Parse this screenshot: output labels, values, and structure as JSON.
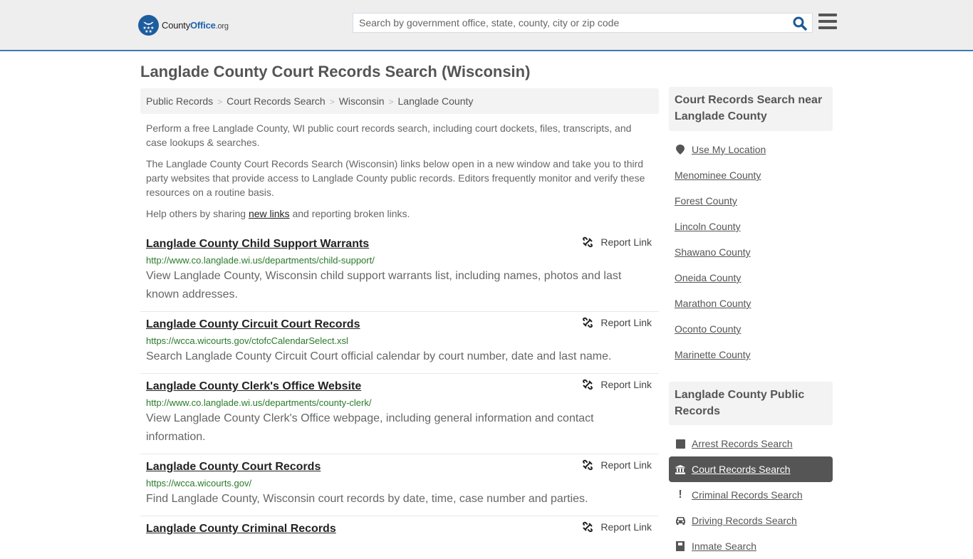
{
  "header": {
    "logo": {
      "name_part1": "County",
      "name_part2": "Office",
      "tld": ".org"
    },
    "search": {
      "placeholder": "Search by government office, state, county, city or zip code",
      "value": ""
    },
    "search_icon": "search-icon",
    "menu_icon": "hamburger-menu-icon"
  },
  "page": {
    "title": "Langlade County Court Records Search (Wisconsin)",
    "breadcrumb": [
      "Public Records",
      "Court Records Search",
      "Wisconsin",
      "Langlade County"
    ],
    "intro": {
      "p1": "Perform a free Langlade County, WI public court records search, including court dockets, files, transcripts, and case lookups & searches.",
      "p2": "The Langlade County Court Records Search (Wisconsin) links below open in a new window and take you to third party websites that provide access to Langlade County public records. Editors frequently monitor and verify these resources on a routine basis.",
      "p3_before": "Help others by sharing ",
      "p3_link": "new links",
      "p3_after": " and reporting broken links."
    }
  },
  "results": [
    {
      "title": "Langlade County Child Support Warrants",
      "url": "http://www.co.langlade.wi.us/departments/child-support/",
      "description": "View Langlade County, Wisconsin child support warrants list, including names, photos and last known addresses.",
      "report_label": "Report Link"
    },
    {
      "title": "Langlade County Circuit Court Records",
      "url": "https://wcca.wicourts.gov/ctofcCalendarSelect.xsl",
      "description": "Search Langlade County Circuit Court official calendar by court number, date and last name.",
      "report_label": "Report Link"
    },
    {
      "title": "Langlade County Clerk's Office Website",
      "url": "http://www.co.langlade.wi.us/departments/county-clerk/",
      "description": "View Langlade County Clerk's Office webpage, including general information and contact information.",
      "report_label": "Report Link"
    },
    {
      "title": "Langlade County Court Records",
      "url": "https://wcca.wicourts.gov/",
      "description": "Find Langlade County, Wisconsin court records by date, time, case number and parties.",
      "report_label": "Report Link"
    },
    {
      "title": "Langlade County Criminal Records",
      "url": "",
      "description": "",
      "report_label": "Report Link"
    }
  ],
  "sidebar": {
    "nearby": {
      "heading": "Court Records Search near Langlade County",
      "use_location": "Use My Location",
      "counties": [
        "Menominee County",
        "Forest County",
        "Lincoln County",
        "Shawano County",
        "Oneida County",
        "Marathon County",
        "Oconto County",
        "Marinette County"
      ]
    },
    "public_records": {
      "heading": "Langlade County Public Records",
      "items": [
        {
          "label": "Arrest Records Search",
          "icon": "square-icon",
          "active": false
        },
        {
          "label": "Court Records Search",
          "icon": "courthouse-icon",
          "active": true
        },
        {
          "label": "Criminal Records Search",
          "icon": "exclamation-icon",
          "active": false
        },
        {
          "label": "Driving Records Search",
          "icon": "car-icon",
          "active": false
        },
        {
          "label": "Inmate Search",
          "icon": "inmate-icon",
          "active": false
        }
      ]
    }
  },
  "colors": {
    "header_bg": "#eeeeee",
    "header_border": "#3a7bb0",
    "brand_blue": "#1e64ae",
    "url_green": "#2a7a2a",
    "active_item_bg": "#555555"
  }
}
